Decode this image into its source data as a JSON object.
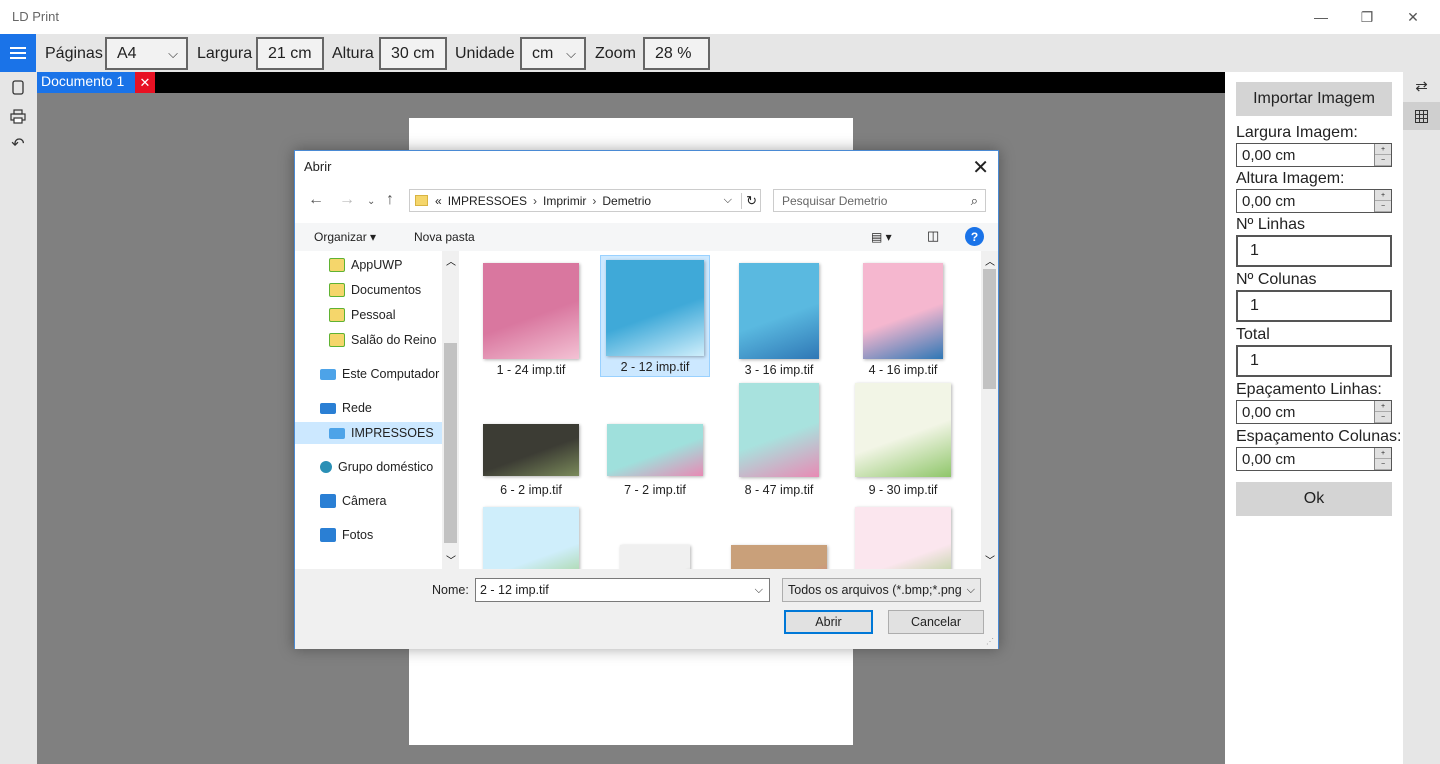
{
  "window": {
    "title": "LD Print",
    "minimize": "—",
    "maximize": "❐",
    "close": "✕"
  },
  "toolbar": {
    "pages_label": "Páginas",
    "pages_value": "A4",
    "width_label": "Largura",
    "width_value": "21 cm",
    "height_label": "Altura",
    "height_value": "30 cm",
    "unit_label": "Unidade",
    "unit_value": "cm",
    "zoom_label": "Zoom",
    "zoom_value": "28 %"
  },
  "tabs": [
    {
      "label": "Documento 1",
      "close": "✕"
    }
  ],
  "right_panel": {
    "import_button": "Importar Imagem",
    "image_width_label": "Largura Imagem:",
    "image_width_value": "0,00 cm",
    "image_height_label": "Altura Imagem:",
    "image_height_value": "0,00 cm",
    "rows_label": "Nº Linhas",
    "rows_value": "1",
    "cols_label": "Nº Colunas",
    "cols_value": "1",
    "total_label": "Total",
    "total_value": "1",
    "row_spacing_label": "Epaçamento Linhas:",
    "row_spacing_value": "0,00 cm",
    "col_spacing_label": "Espaçamento Colunas:",
    "col_spacing_value": "0,00 cm",
    "ok_button": "Ok"
  },
  "dialog": {
    "title": "Abrir",
    "breadcrumb": [
      "«",
      "IMPRESSOES",
      "Imprimir",
      "Demetrio"
    ],
    "search_placeholder": "Pesquisar Demetrio",
    "organize": "Organizar ▾",
    "new_folder": "Nova pasta",
    "nav_items": [
      {
        "label": "AppUWP",
        "icon": "folder-sync-icon"
      },
      {
        "label": "Documentos",
        "icon": "folder-sync-icon"
      },
      {
        "label": "Pessoal",
        "icon": "folder-sync-icon"
      },
      {
        "label": "Salão do Reino",
        "icon": "folder-sync-icon"
      },
      {
        "label": "Este Computador",
        "icon": "computer-icon"
      },
      {
        "label": "Rede",
        "icon": "network-icon"
      },
      {
        "label": "IMPRESSOES",
        "icon": "network-computer-icon",
        "selected": true
      },
      {
        "label": "Grupo doméstico",
        "icon": "homegroup-icon"
      },
      {
        "label": "Câmera",
        "icon": "camera-folder-icon"
      },
      {
        "label": "Fotos",
        "icon": "photos-folder-icon"
      }
    ],
    "files": [
      {
        "name": "1 - 24 imp.tif",
        "colors": [
          "#d9779f",
          "#f3c2d4"
        ]
      },
      {
        "name": "2 - 12 imp.tif",
        "colors": [
          "#3fa9d8",
          "#cfeefb"
        ],
        "selected": true
      },
      {
        "name": "3 - 16 imp.tif",
        "colors": [
          "#5ab9e0",
          "#2f77b5"
        ]
      },
      {
        "name": "4 - 16 imp.tif",
        "colors": [
          "#f5b7cf",
          "#2f77b5"
        ]
      },
      {
        "name": "6 - 2 imp.tif",
        "colors": [
          "#3c3c34",
          "#7a8a5a"
        ]
      },
      {
        "name": "7 - 2 imp.tif",
        "colors": [
          "#9fe0dc",
          "#e88ab4"
        ]
      },
      {
        "name": "8 - 47 imp.tif",
        "colors": [
          "#a8e2de",
          "#e88ab4"
        ]
      },
      {
        "name": "9 - 30 imp.tif",
        "colors": [
          "#f2f5e6",
          "#8fc66a"
        ]
      },
      {
        "name": "",
        "colors": [
          "#cfeefb",
          "#8fc66a"
        ]
      },
      {
        "name": "",
        "colors": [
          "#f0f0f0",
          "#55603e"
        ]
      },
      {
        "name": "",
        "colors": [
          "#c9a07a",
          "#e06a8a"
        ]
      },
      {
        "name": "",
        "colors": [
          "#fbe6ee",
          "#8fc66a"
        ]
      }
    ],
    "name_label": "Nome:",
    "name_value": "2 - 12 imp.tif",
    "filetype_value": "Todos os arquivos (*.bmp;*.png",
    "open_button": "Abrir",
    "cancel_button": "Cancelar"
  }
}
